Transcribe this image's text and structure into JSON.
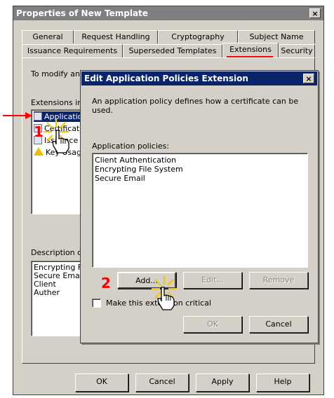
{
  "window": {
    "title": "Properties of New Template",
    "close_glyph": "×",
    "tabs_row1": [
      "General",
      "Request Handling",
      "Cryptography",
      "Subject Name"
    ],
    "tabs_row2": [
      "Issuance Requirements",
      "Superseded Templates",
      "Extensions",
      "Security"
    ],
    "active_tab": "Extensions",
    "intro_text": "To modify an",
    "extensions_label": "Extensions in",
    "extensions": [
      {
        "label": "Applicatio",
        "icon": "certificate-icon"
      },
      {
        "label": "Certificate",
        "icon": "certificate-icon"
      },
      {
        "label": "Issuance",
        "icon": "certificate-icon"
      },
      {
        "label": "Key Usag",
        "icon": "warning-icon"
      }
    ],
    "description_label": "Description o",
    "description_lines": [
      "Encrypting F",
      "Secure Emai",
      "Client Auther"
    ],
    "buttons": {
      "ok": "OK",
      "cancel": "Cancel",
      "apply": "Apply",
      "help": "Help"
    }
  },
  "dialog": {
    "title": "Edit Application Policies Extension",
    "close_glyph": "×",
    "description": "An application policy defines how a certificate can be used.",
    "policies_label": "Application policies:",
    "policies": [
      "Client Authentication",
      "Encrypting File System",
      "Secure Email"
    ],
    "buttons": {
      "add": "Add...",
      "edit": "Edit...",
      "remove": "Remove",
      "ok": "OK",
      "cancel": "Cancel"
    },
    "critical_label": "Make this extension critical",
    "critical_checked": false
  },
  "annotations": {
    "step1": "1",
    "step2": "2"
  },
  "colors": {
    "accent_red": "#ff0000",
    "dialog_title_bg": "#0a246a",
    "window_title_bg": "#7f7f7f",
    "face": "#d4d0c8"
  }
}
